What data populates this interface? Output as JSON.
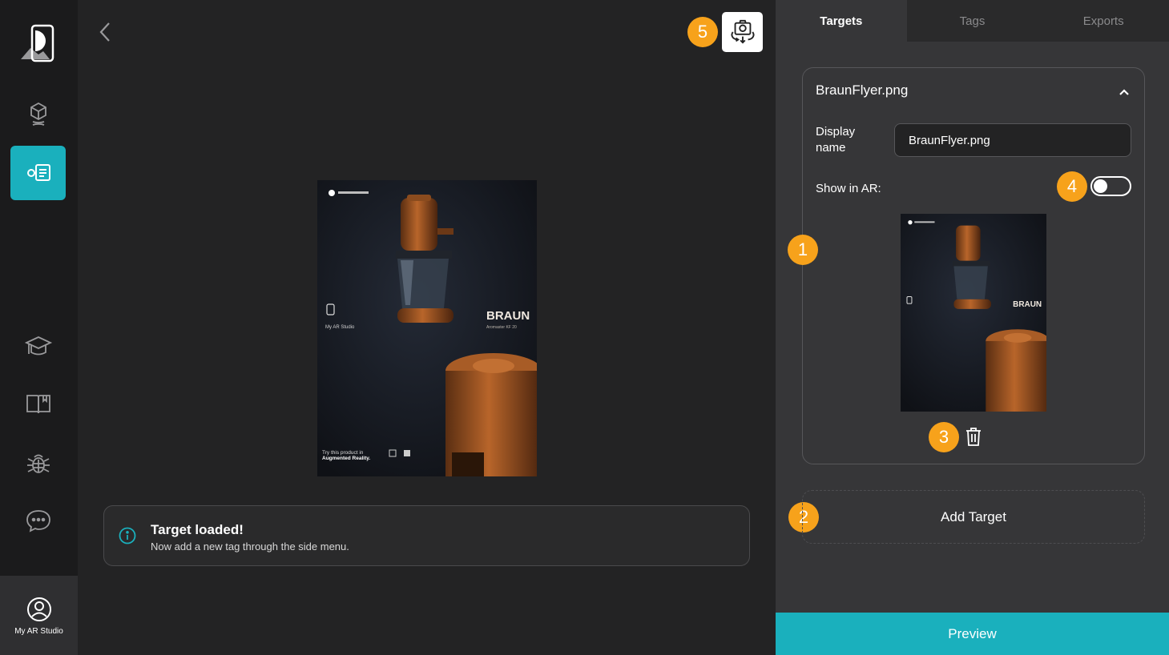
{
  "sidebar": {
    "items": [
      {
        "name": "3d-model-icon"
      },
      {
        "name": "image-target-icon",
        "active": true
      },
      {
        "name": "graduation-cap-icon"
      },
      {
        "name": "book-icon"
      },
      {
        "name": "bug-icon"
      },
      {
        "name": "chat-icon"
      }
    ],
    "account_label": "My AR Studio"
  },
  "canvas": {
    "badge_snapshot": "5",
    "flyer": {
      "brand": "BRAUN",
      "model": "Aromaster KF 20",
      "studio": "My AR Studio",
      "tagline_1": "Try this product in",
      "tagline_2": "Augmented Reality."
    },
    "toast": {
      "title": "Target loaded!",
      "message": "Now add a new tag through the side menu."
    }
  },
  "panel": {
    "tabs": [
      "Targets",
      "Tags",
      "Exports"
    ],
    "active_tab": "Targets",
    "target": {
      "title": "BraunFlyer.png",
      "display_name_label": "Display name",
      "display_name_value": "BraunFlyer.png",
      "show_in_ar_label": "Show in AR:",
      "show_in_ar": false
    },
    "badges": {
      "card": "1",
      "add": "2",
      "delete": "3",
      "toggle": "4"
    },
    "add_target_label": "Add Target",
    "preview_label": "Preview"
  },
  "colors": {
    "accent": "#1ab0bd",
    "badge": "#f7a21b",
    "panel": "#363638",
    "canvas": "#232324"
  }
}
